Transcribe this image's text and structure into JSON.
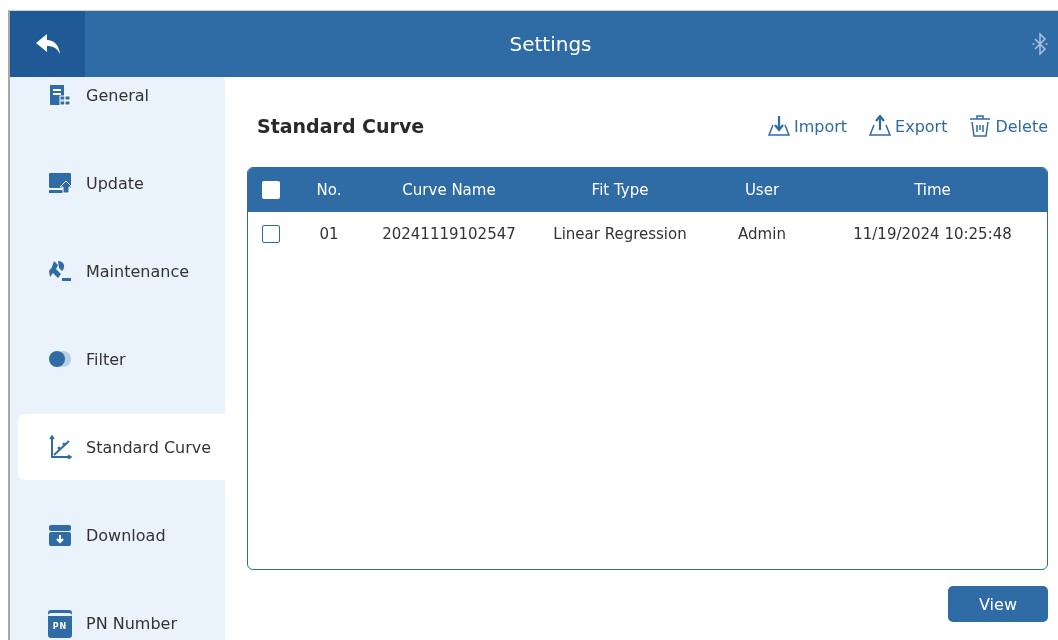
{
  "window": {
    "title": "Settings"
  },
  "sidebar": {
    "items": [
      {
        "label": "General",
        "kind": "general",
        "selected": false
      },
      {
        "label": "Update",
        "kind": "update",
        "selected": false
      },
      {
        "label": "Maintenance",
        "kind": "maintenance",
        "selected": false
      },
      {
        "label": "Filter",
        "kind": "filter",
        "selected": false
      },
      {
        "label": "Standard Curve",
        "kind": "curve",
        "selected": true
      },
      {
        "label": "Download",
        "kind": "download",
        "selected": false
      },
      {
        "label": "PN Number",
        "kind": "pn",
        "selected": false,
        "icon_text": "PN"
      }
    ]
  },
  "page": {
    "title": "Standard Curve",
    "actions": [
      {
        "label": "Import",
        "kind": "import"
      },
      {
        "label": "Export",
        "kind": "export"
      },
      {
        "label": "Delete",
        "kind": "delete"
      }
    ]
  },
  "table": {
    "select_all": {
      "checked": false
    },
    "columns": [
      "No.",
      "Curve Name",
      "Fit Type",
      "User",
      "Time"
    ],
    "rows": [
      {
        "checked": false,
        "cells": [
          "01",
          "20241119102547",
          "Linear Regression",
          "Admin",
          "11/19/2024 10:25:48"
        ]
      }
    ]
  },
  "buttons": [
    {
      "label": "View"
    }
  ]
}
